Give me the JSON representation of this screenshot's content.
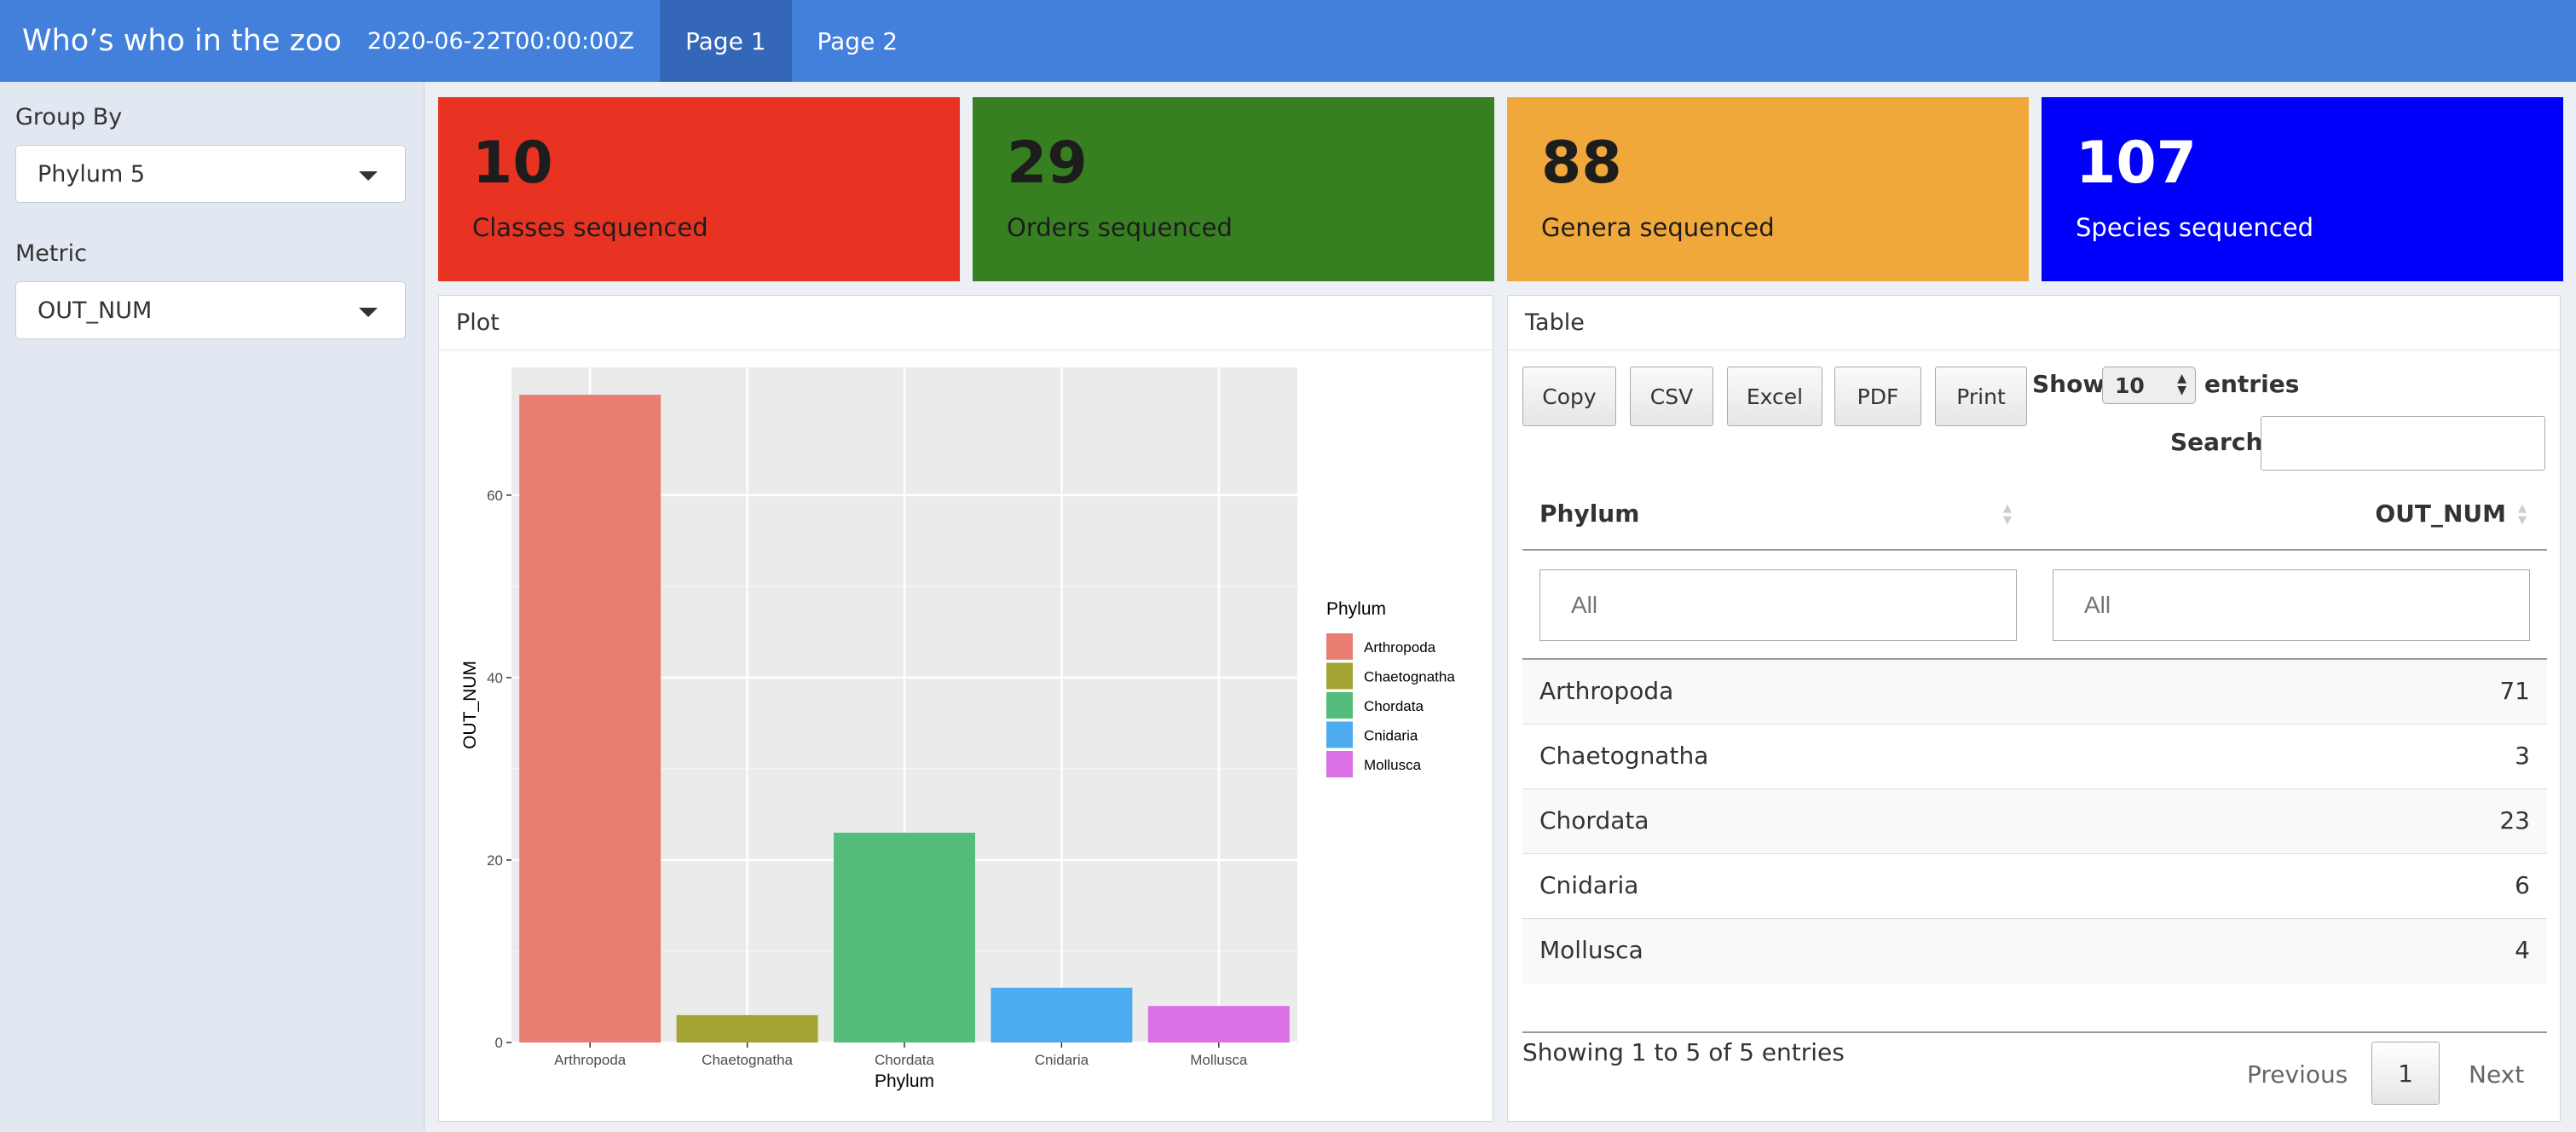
{
  "header": {
    "title": "Who’s who in the zoo",
    "timestamp": "2020-06-22T00:00:00Z",
    "tabs": [
      {
        "label": "Page 1",
        "active": true
      },
      {
        "label": "Page 2",
        "active": false
      }
    ],
    "color": "#4380dc"
  },
  "sidebar": {
    "group_by_label": "Group By",
    "group_by_value": "Phylum 5",
    "metric_label": "Metric",
    "metric_value": "OUT_NUM"
  },
  "value_boxes": [
    {
      "number": "10",
      "caption": "Classes sequenced",
      "color": "#e83323"
    },
    {
      "number": "29",
      "caption": "Orders sequenced",
      "color": "#378021"
    },
    {
      "number": "88",
      "caption": "Genera sequenced",
      "color": "#f1a83b"
    },
    {
      "number": "107",
      "caption": "Species sequenced",
      "color": "#0000fa"
    }
  ],
  "plot_panel": {
    "title": "Plot"
  },
  "chart_data": {
    "type": "bar",
    "categories": [
      "Arthropoda",
      "Chaetognatha",
      "Chordata",
      "Cnidaria",
      "Mollusca"
    ],
    "values": [
      71,
      3,
      23,
      6,
      4
    ],
    "colors": [
      "#e87d72",
      "#a3a431",
      "#55bd7c",
      "#4dabf0",
      "#da70e5"
    ],
    "xlabel": "Phylum",
    "ylabel": "OUT_NUM",
    "ylim": [
      0,
      74
    ],
    "yticks": [
      0,
      20,
      40,
      60
    ],
    "grid": true,
    "legend": {
      "title": "Phylum",
      "position": "right"
    }
  },
  "table_panel": {
    "title": "Table",
    "buttons": [
      "Copy",
      "CSV",
      "Excel",
      "PDF",
      "Print"
    ],
    "show_label": "Show",
    "entries_value": "10",
    "entries_label": "entries",
    "search_label": "Search:",
    "columns": [
      "Phylum",
      "OUT_NUM"
    ],
    "filter_placeholders": [
      "All",
      "All"
    ],
    "rows": [
      [
        "Arthropoda",
        "71"
      ],
      [
        "Chaetognatha",
        "3"
      ],
      [
        "Chordata",
        "23"
      ],
      [
        "Cnidaria",
        "6"
      ],
      [
        "Mollusca",
        "4"
      ]
    ],
    "info": "Showing 1 to 5 of 5 entries",
    "pagination": {
      "previous": "Previous",
      "current": "1",
      "next": "Next"
    }
  }
}
